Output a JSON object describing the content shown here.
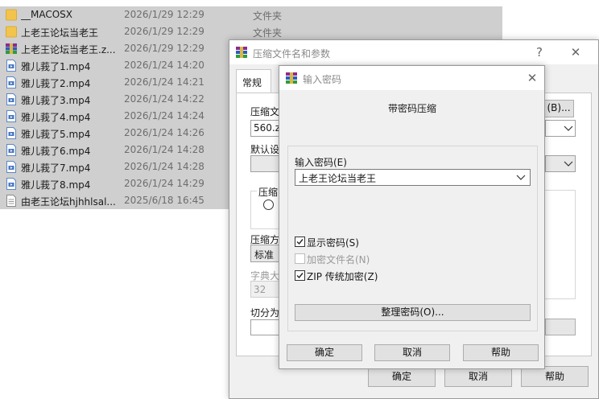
{
  "files": [
    {
      "icon": "folder-icon",
      "name": "__MACOSX",
      "date": "2026/1/29 12:29",
      "type": "文件夹"
    },
    {
      "icon": "folder-icon",
      "name": "上老王论坛当老王",
      "date": "2026/1/29 12:29",
      "type": "文件夹"
    },
    {
      "icon": "rar-archive-icon",
      "name": "上老王论坛当老王.z...",
      "date": "2026/1/29 12:29",
      "type": ""
    },
    {
      "icon": "video-file-icon",
      "name": "雅儿莪了1.mp4",
      "date": "2026/1/24 14:20",
      "type": ""
    },
    {
      "icon": "video-file-icon",
      "name": "雅儿莪了2.mp4",
      "date": "2026/1/24 14:21",
      "type": ""
    },
    {
      "icon": "video-file-icon",
      "name": "雅儿莪了3.mp4",
      "date": "2026/1/24 14:22",
      "type": ""
    },
    {
      "icon": "video-file-icon",
      "name": "雅儿莪了4.mp4",
      "date": "2026/1/24 14:24",
      "type": ""
    },
    {
      "icon": "video-file-icon",
      "name": "雅儿莪了5.mp4",
      "date": "2026/1/24 14:26",
      "type": ""
    },
    {
      "icon": "video-file-icon",
      "name": "雅儿莪了6.mp4",
      "date": "2026/1/24 14:28",
      "type": ""
    },
    {
      "icon": "video-file-icon",
      "name": "雅儿莪了7.mp4",
      "date": "2026/1/24 14:28",
      "type": ""
    },
    {
      "icon": "video-file-icon",
      "name": "雅儿莪了8.mp4",
      "date": "2026/1/24 14:29",
      "type": ""
    },
    {
      "icon": "text-file-icon",
      "name": "由老王论坛hjhhlsal...",
      "date": "2025/6/18 16:45",
      "type": ""
    }
  ],
  "compress_dialog": {
    "title": "压缩文件名和参数",
    "help_symbol": "?",
    "close_symbol": "✕",
    "tab_general": "常规",
    "archive_name_label": "压缩文",
    "browse_button": "(B)...",
    "archive_name_value": "560.zip",
    "default_settings_label": "默认设",
    "compression_format_label": "压缩",
    "compression_method_label": "压缩方",
    "compression_method_value": "标准",
    "dictionary_label": "字典大",
    "dictionary_value": "32",
    "split_label": "切分为",
    "ok": "确定",
    "cancel": "取消",
    "help": "帮助"
  },
  "password_dialog": {
    "title": "输入密码",
    "close_symbol": "✕",
    "heading": "带密码压缩",
    "enter_password_label": "输入密码(E)",
    "password_value": "上老王论坛当老王",
    "show_password": {
      "label": "显示密码(S)",
      "checked": true
    },
    "encrypt_names": {
      "label": "加密文件名(N)",
      "checked": false,
      "disabled": true
    },
    "zip_legacy": {
      "label": "ZIP 传统加密(Z)",
      "checked": true
    },
    "organize_button": "整理密码(O)...",
    "ok": "确定",
    "cancel": "取消",
    "help": "帮助"
  }
}
